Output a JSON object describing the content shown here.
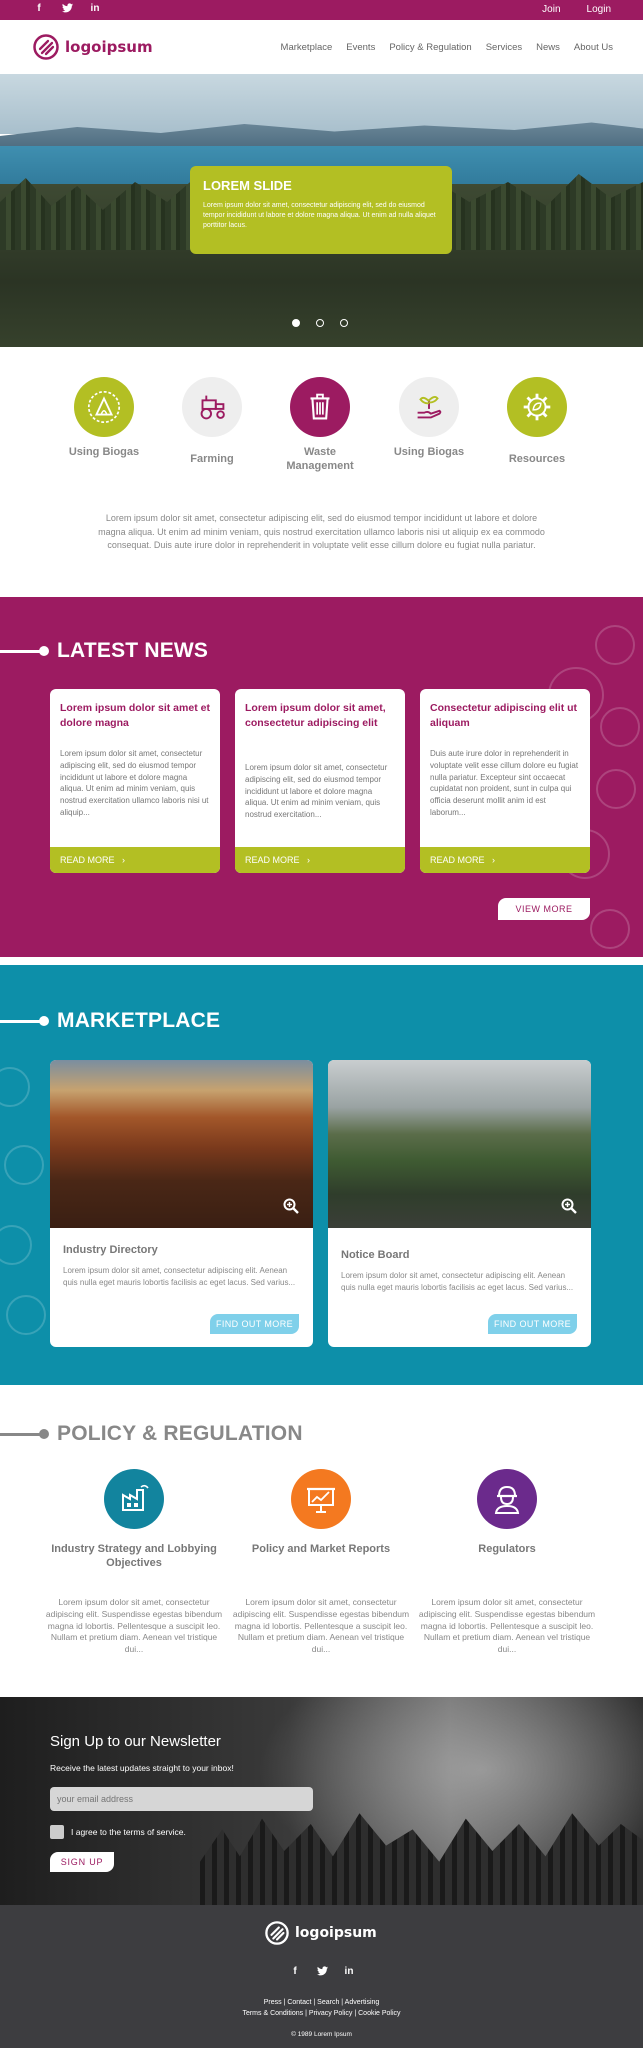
{
  "topbar": {
    "social": [
      {
        "icon": "facebook-icon",
        "glyph": "f"
      },
      {
        "icon": "twitter-icon",
        "glyph": "t"
      },
      {
        "icon": "linkedin-icon",
        "glyph": "in"
      }
    ],
    "join": "Join",
    "login": "Login"
  },
  "brand": {
    "name": "logoipsum",
    "color": "#9c1b61"
  },
  "nav": [
    "Marketplace",
    "Events",
    "Policy & Regulation",
    "Services",
    "News",
    "About Us"
  ],
  "hero": {
    "title": "LOREM SLIDE",
    "text": "Lorem ipsum dolor sit amet, consectetur adipiscing elit, sed do eiusmod tempor incididunt ut labore et dolore magna aliqua. Ut enim ad nulla aliquet porttitor lacus.",
    "slides": 3,
    "active_slide": 1,
    "accent": "#b3bf23"
  },
  "features": {
    "items": [
      {
        "label": "Using Biogas",
        "icon": "biogas-icon",
        "color": "#b3bf23"
      },
      {
        "label": "Farming",
        "icon": "tractor-icon",
        "color": "#eeeeee"
      },
      {
        "label": "Waste Management",
        "icon": "trash-icon",
        "color": "#9c1b61"
      },
      {
        "label": "Using Biogas",
        "icon": "plant-hand-icon",
        "color": "#eeeeee"
      },
      {
        "label": "Resources",
        "icon": "gear-leaf-icon",
        "color": "#b3bf23"
      }
    ],
    "intro": "Lorem ipsum dolor sit amet, consectetur adipiscing elit, sed do eiusmod tempor incididunt ut labore et dolore magna aliqua. Ut enim ad minim veniam, quis nostrud exercitation ullamco laboris nisi ut aliquip ex ea commodo consequat. Duis aute irure dolor in reprehenderit in voluptate velit esse cillum dolore eu fugiat nulla pariatur."
  },
  "news": {
    "title": "LATEST NEWS",
    "bg": "#9c1b61",
    "cards": [
      {
        "title": "Lorem ipsum dolor sit amet et dolore magna",
        "body": "Lorem ipsum dolor sit amet, consectetur adipiscing elit, sed do eiusmod tempor incididunt ut labore et dolore magna aliqua. Ut enim ad minim veniam, quis nostrud exercitation ullamco laboris nisi ut aliquip...",
        "more": "READ MORE"
      },
      {
        "title": "Lorem ipsum dolor sit amet, consectetur adipiscing elit",
        "body": "Lorem ipsum dolor sit amet, consectetur adipiscing elit, sed do eiusmod tempor incididunt ut labore et dolore magna aliqua. Ut enim ad minim veniam, quis nostrud exercitation...",
        "more": "READ MORE"
      },
      {
        "title": "Consectetur adipiscing elit ut aliquam",
        "body": "Duis aute irure dolor in reprehenderit in voluptate velit esse cillum dolore eu fugiat nulla pariatur. Excepteur sint occaecat cupidatat non proident, sunt in culpa qui officia deserunt mollit anim id est laborum...",
        "more": "READ MORE"
      }
    ],
    "view_more": "VIEW MORE"
  },
  "market": {
    "title": "MARKETPLACE",
    "bg": "#0d8fa9",
    "cards": [
      {
        "title": "Industry Directory",
        "body": "Lorem ipsum dolor sit amet, consectetur adipiscing elit. Aenean quis nulla eget mauris lobortis facilisis ac eget lacus. Sed varius...",
        "button": "FIND OUT MORE"
      },
      {
        "title": "Notice Board",
        "body": "Lorem ipsum dolor sit amet, consectetur adipiscing elit. Aenean quis nulla eget mauris lobortis facilisis ac eget lacus. Sed varius...",
        "button": "FIND OUT MORE"
      }
    ]
  },
  "policy": {
    "title": "POLICY & REGULATION",
    "items": [
      {
        "title": "Industry Strategy and Lobbying Objectives",
        "icon": "factory-icon",
        "color": "#12849e",
        "body": "Lorem ipsum dolor sit amet, consectetur adipiscing elit. Suspendisse egestas bibendum magna id lobortis. Pellentesque a suscipit leo. Nullam et pretium diam. Aenean vel tristique dui..."
      },
      {
        "title": "Policy and Market Reports",
        "icon": "presentation-chart-icon",
        "color": "#f47920",
        "body": "Lorem ipsum dolor sit amet, consectetur adipiscing elit. Suspendisse egestas bibendum magna id lobortis. Pellentesque a suscipit leo. Nullam et pretium diam. Aenean vel tristique dui..."
      },
      {
        "title": "Regulators",
        "icon": "worker-icon",
        "color": "#6b2a8c",
        "body": "Lorem ipsum dolor sit amet, consectetur adipiscing elit. Suspendisse egestas bibendum magna id lobortis. Pellentesque a suscipit leo. Nullam et pretium diam. Aenean vel tristique dui..."
      }
    ]
  },
  "newsletter": {
    "title": "Sign Up to our Newsletter",
    "subtitle": "Receive the latest updates straight to your inbox!",
    "email_placeholder": "your email address",
    "terms": "I agree to the terms of service.",
    "button": "SIGN UP"
  },
  "footer": {
    "brand": "logoipsum",
    "social": [
      {
        "icon": "facebook-icon",
        "glyph": "f"
      },
      {
        "icon": "twitter-icon",
        "glyph": "t"
      },
      {
        "icon": "linkedin-icon",
        "glyph": "in"
      }
    ],
    "links_line1": "Press | Contact | Search | Advertising",
    "links_line2": "Terms & Conditions | Privacy Policy | Cookie Policy",
    "copyright": "© 1989 Lorem Ipsum"
  }
}
